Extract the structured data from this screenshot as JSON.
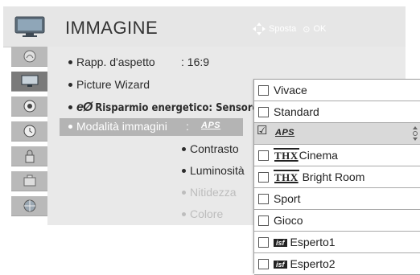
{
  "header": {
    "title": "IMMAGINE",
    "hint_move": "Sposta",
    "hint_ok": "OK",
    "hint_ok_symbol": "⊙"
  },
  "sidebar": {
    "icons": [
      "antenna-icon",
      "picture-icon",
      "audio-icon",
      "time-icon",
      "lock-icon",
      "options-icon",
      "network-icon"
    ],
    "active_index": 1
  },
  "menu": {
    "aspect_label": "Rapp. d'aspetto",
    "aspect_value": ": 16:9",
    "wizard_label": "Picture Wizard",
    "eco_symbol": "eØ",
    "eco_label": "Risparmio energetico: Sensore int",
    "mode_label": "Modalità immagini",
    "mode_colon": ":",
    "mode_value": "APS",
    "contrast_label": "Contrasto",
    "brightness_label": "Luminosità",
    "sharpness_label": "Nitidezza",
    "color_label": "Colore"
  },
  "dropdown": {
    "items": [
      {
        "label": "Vivace",
        "checked": false
      },
      {
        "label": "Standard",
        "checked": false
      },
      {
        "label": "APS",
        "checked": true
      },
      {
        "label_prefix": "THX",
        "label": "Cinema",
        "checked": false
      },
      {
        "label_prefix": "THX",
        "label": "Bright Room",
        "checked": false
      },
      {
        "label": "Sport",
        "checked": false
      },
      {
        "label": "Gioco",
        "checked": false
      },
      {
        "label_prefix": "isf",
        "label": "Esperto1",
        "checked": false
      },
      {
        "label_prefix": "isf",
        "label": "Esperto2",
        "checked": false
      }
    ],
    "check_symbol": "☑"
  },
  "colors": {
    "header_bg": "#e6e6e6",
    "panel_bg": "#e9e9e9",
    "selected_row": "#b4b4b4",
    "active_icon_tile": "#7a7a7a",
    "dropdown_selected": "#d9d9d9"
  }
}
